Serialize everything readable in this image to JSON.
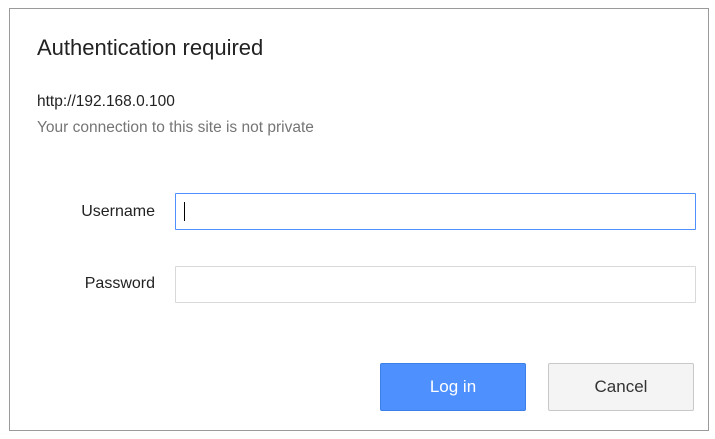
{
  "dialog": {
    "title": "Authentication required",
    "url": "http://192.168.0.100",
    "warning": "Your connection to this site is not private"
  },
  "form": {
    "username_label": "Username",
    "username_value": "",
    "password_label": "Password",
    "password_value": ""
  },
  "buttons": {
    "login_label": "Log in",
    "cancel_label": "Cancel"
  },
  "colors": {
    "primary_button": "#4d90fe",
    "focus_border": "#4d90fe",
    "secondary_text": "#757575"
  }
}
